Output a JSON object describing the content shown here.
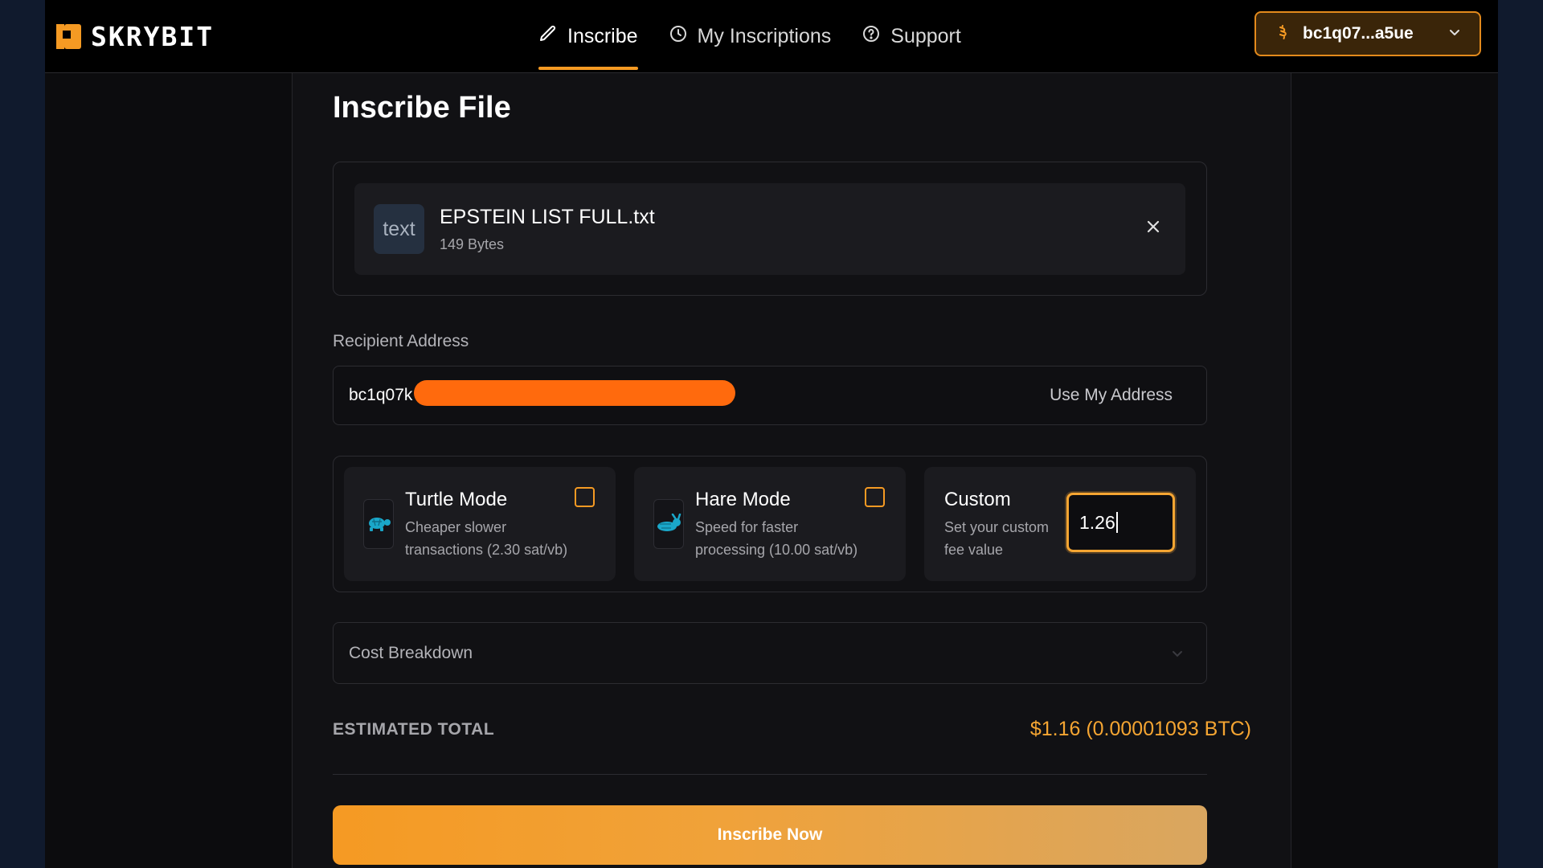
{
  "brand": {
    "name": "SKRYBIT"
  },
  "nav": {
    "items": [
      {
        "label": "Inscribe",
        "icon": "pencil-icon",
        "active": true
      },
      {
        "label": "My Inscriptions",
        "icon": "clock-icon",
        "active": false
      },
      {
        "label": "Support",
        "icon": "help-circle-icon",
        "active": false
      }
    ]
  },
  "wallet": {
    "address": "bc1q07...a5ue",
    "icon": "bitcoin-icon"
  },
  "page": {
    "title": "Inscribe File"
  },
  "file": {
    "badge": "text",
    "name": "EPSTEIN LIST FULL.txt",
    "size": "149 Bytes"
  },
  "recipient": {
    "label": "Recipient Address",
    "value_visible": "bc1q07k",
    "use_my_address": "Use My Address"
  },
  "fees": {
    "turtle": {
      "title": "Turtle Mode",
      "description": "Cheaper slower transactions (2.30 sat/vb)",
      "checked": false
    },
    "hare": {
      "title": "Hare Mode",
      "description": "Speed for faster processing (10.00 sat/vb)",
      "checked": false
    },
    "custom": {
      "title": "Custom",
      "description": "Set your custom fee value",
      "value": "1.26"
    }
  },
  "cost": {
    "label": "Cost Breakdown"
  },
  "estimate": {
    "label": "ESTIMATED TOTAL",
    "value": "$1.16 (0.00001093 BTC)"
  },
  "cta": {
    "label": "Inscribe Now"
  },
  "colors": {
    "accent": "#f59a23",
    "redaction": "#ff6a0d",
    "background": "#0c0c0e",
    "outer": "#101a2d"
  }
}
